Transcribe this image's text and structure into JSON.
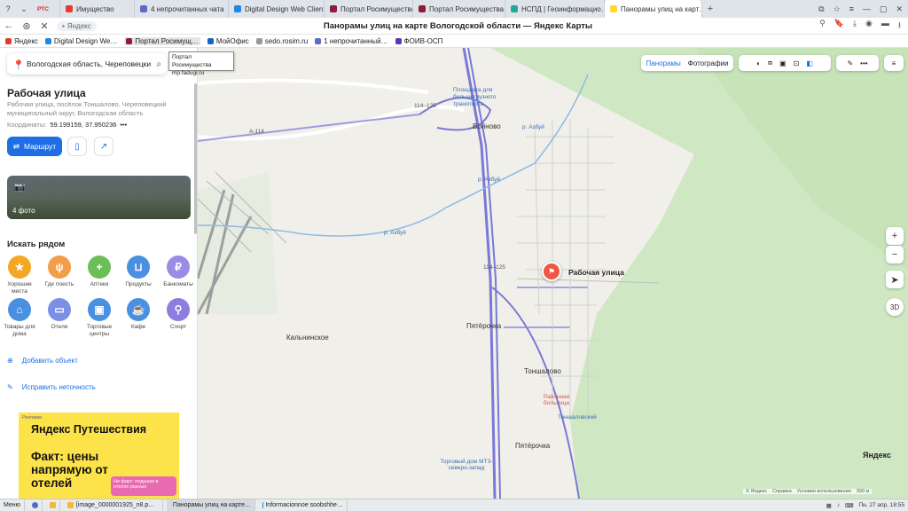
{
  "browser": {
    "tabs": [
      {
        "label": "Имущество",
        "color": "#e53935"
      },
      {
        "label": "4 непрочитанных чата",
        "color": "#5c6bc0"
      },
      {
        "label": "Digital Design Web Client",
        "color": "#1e88e5"
      },
      {
        "label": "Портал Росимущества",
        "color": "#8e1b3a"
      },
      {
        "label": "Портал Росимущества",
        "color": "#8e1b3a"
      },
      {
        "label": "НСПД | Геоинформацио…",
        "color": "#26a69a"
      },
      {
        "label": "Панорамы улиц на карт…",
        "color": "#fdd835",
        "active": true
      }
    ],
    "rtc_label": "РТС",
    "address_host": "Яндекс",
    "page_title": "Панорамы улиц на карте Вологодской области — Яндекс Карты",
    "bookmarks": [
      {
        "label": "Яндекс",
        "color": "#e53935"
      },
      {
        "label": "Digital Design We…",
        "color": "#1e88e5"
      },
      {
        "label": "Портал Росимущ…",
        "color": "#8e1b3a"
      },
      {
        "label": "МойОфис",
        "color": "#1565c0"
      },
      {
        "label": "sedo.rosim.ru",
        "color": "#999999"
      },
      {
        "label": "1 непрочитанный…",
        "color": "#5c6bc0"
      },
      {
        "label": "ФОИВ-ОСП",
        "color": "#5e35b1"
      }
    ]
  },
  "tooltip": {
    "line1": "Портал Росимущества",
    "line2": "mp.fadugi.ru"
  },
  "sidebar": {
    "search_value": "Вологодская область, Череповецкий",
    "place_title": "Рабочая улица",
    "place_address": "Рабочая улица, посёлок Тоншалово, Череповецкий муниципальный округ, Вологодская область",
    "coords_label": "Координаты:",
    "coords_value": "59.199159, 37.950236",
    "route_label": "Маршрут",
    "photo_count": "4 фото",
    "nearby_title": "Искать рядом",
    "categories": [
      {
        "label": "Хорошие места",
        "color": "#f5a623",
        "icon": "★"
      },
      {
        "label": "Где поесть",
        "color": "#f39c4a",
        "icon": "🍴"
      },
      {
        "label": "Аптеки",
        "color": "#6bbf59",
        "icon": "+"
      },
      {
        "label": "Продукты",
        "color": "#4a90e2",
        "icon": "🛒"
      },
      {
        "label": "Банкоматы",
        "color": "#9b8ae6",
        "icon": "₽"
      },
      {
        "label": "Товары для дома",
        "color": "#4a90e2",
        "icon": "⌂"
      },
      {
        "label": "Отели",
        "color": "#7b8fe6",
        "icon": "▭"
      },
      {
        "label": "Торговые центры",
        "color": "#4a90e2",
        "icon": "▣"
      },
      {
        "label": "Кафе",
        "color": "#4a90e2",
        "icon": "☕"
      },
      {
        "label": "Спорт",
        "color": "#8e7ce0",
        "icon": "⚲"
      }
    ],
    "add_object": "Добавить объект",
    "fix_error": "Исправить неточность"
  },
  "ad": {
    "tag": "Реклама",
    "brand": "Яндекс Путешествия",
    "fact": "Факт: цены напрямую от отелей",
    "bubble": "Не факт: подушки в отелях разные"
  },
  "map": {
    "btn_panoramas": "Панорамы",
    "btn_photos": "Фотографии",
    "marker_label": "Рабочая улица",
    "labels": {
      "voinovo": "Войново",
      "kalninskoe": "Кальнинское",
      "tonshalovo": "Тоншалово",
      "pyaterochka1": "Пятёрочка",
      "pyaterochka2": "Пятёрочка",
      "bolnitsa": "Районная больница",
      "tonshalovsky": "Тоншаловский",
      "mtz": "Торговый дом МТЗ-северо-запад",
      "platform": "Площадка для большегрузного транспорта",
      "a114": "А-114",
      "r114_1": "114–125",
      "r114_2": "114–125",
      "azbua1": "р. Азбуй",
      "azbua2": "р. Азбуй",
      "azbua3": "р. Азбуй"
    },
    "btn_zoom_in": "+",
    "btn_zoom_out": "−",
    "btn_3d": "3D",
    "logo": "Яндекс",
    "footer": [
      "© Яндекс",
      "Справка",
      "Условия использования",
      "300 м"
    ]
  },
  "taskbar": {
    "start": "Меню",
    "items": [
      "[image_0000001925_n8.p…",
      "Панорамы улиц на карте…",
      "Informacionnoe soobshhe…"
    ],
    "clock": "Пн, 27 апр, 18:55"
  }
}
